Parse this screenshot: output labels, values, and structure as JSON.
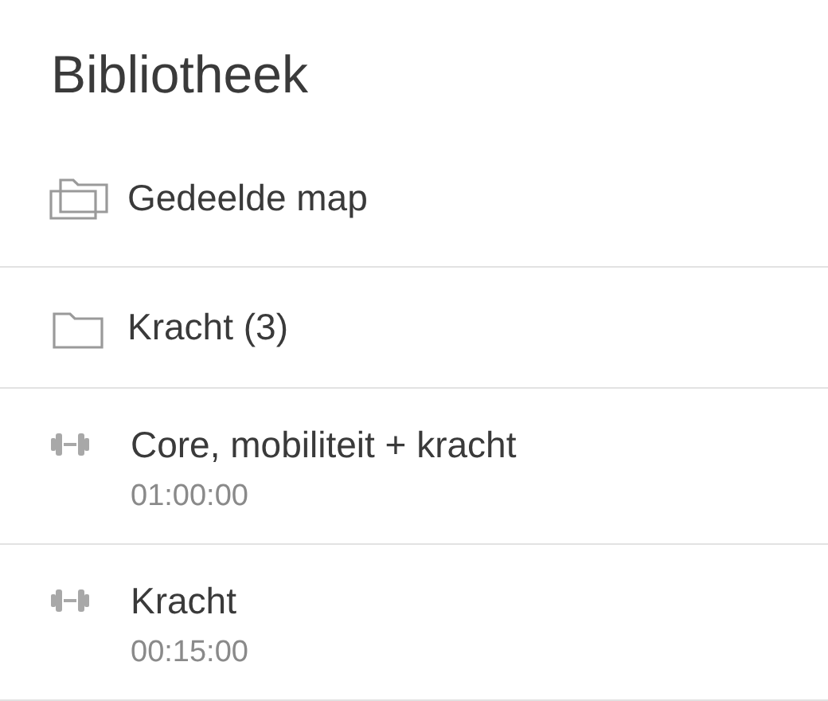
{
  "title": "Bibliotheek",
  "items": [
    {
      "kind": "shared-folder",
      "label": "Gedeelde map"
    },
    {
      "kind": "folder",
      "label": "Kracht (3)"
    },
    {
      "kind": "workout",
      "label": "Core, mobiliteit + kracht",
      "duration": "01:00:00"
    },
    {
      "kind": "workout",
      "label": "Kracht",
      "duration": "00:15:00"
    }
  ]
}
